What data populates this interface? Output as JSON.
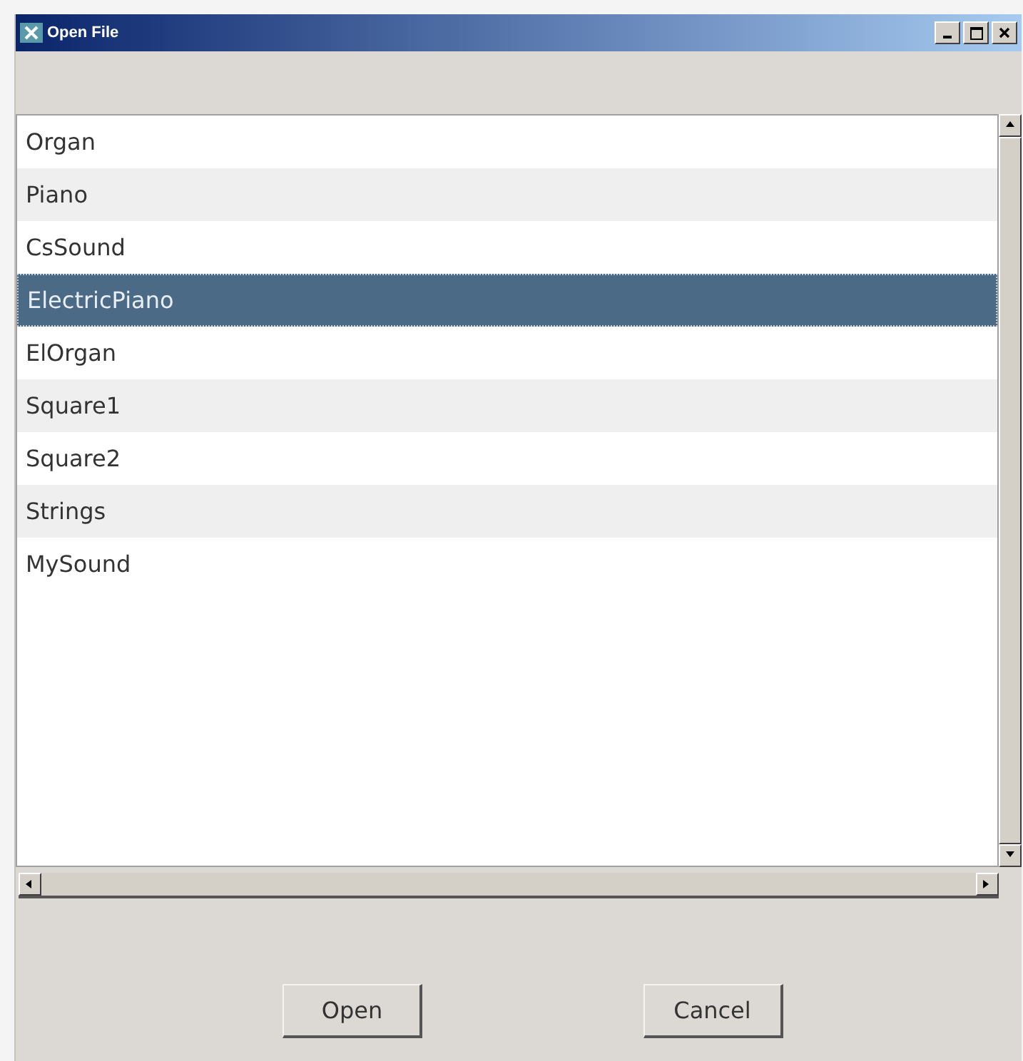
{
  "window": {
    "title": "Open File"
  },
  "files": [
    {
      "name": "Organ",
      "selected": false
    },
    {
      "name": "Piano",
      "selected": false
    },
    {
      "name": "CsSound",
      "selected": false
    },
    {
      "name": "ElectricPiano",
      "selected": true
    },
    {
      "name": "ElOrgan",
      "selected": false
    },
    {
      "name": "Square1",
      "selected": false
    },
    {
      "name": "Square2",
      "selected": false
    },
    {
      "name": "Strings",
      "selected": false
    },
    {
      "name": "MySound",
      "selected": false
    }
  ],
  "buttons": [
    "Open",
    "Cancel"
  ]
}
